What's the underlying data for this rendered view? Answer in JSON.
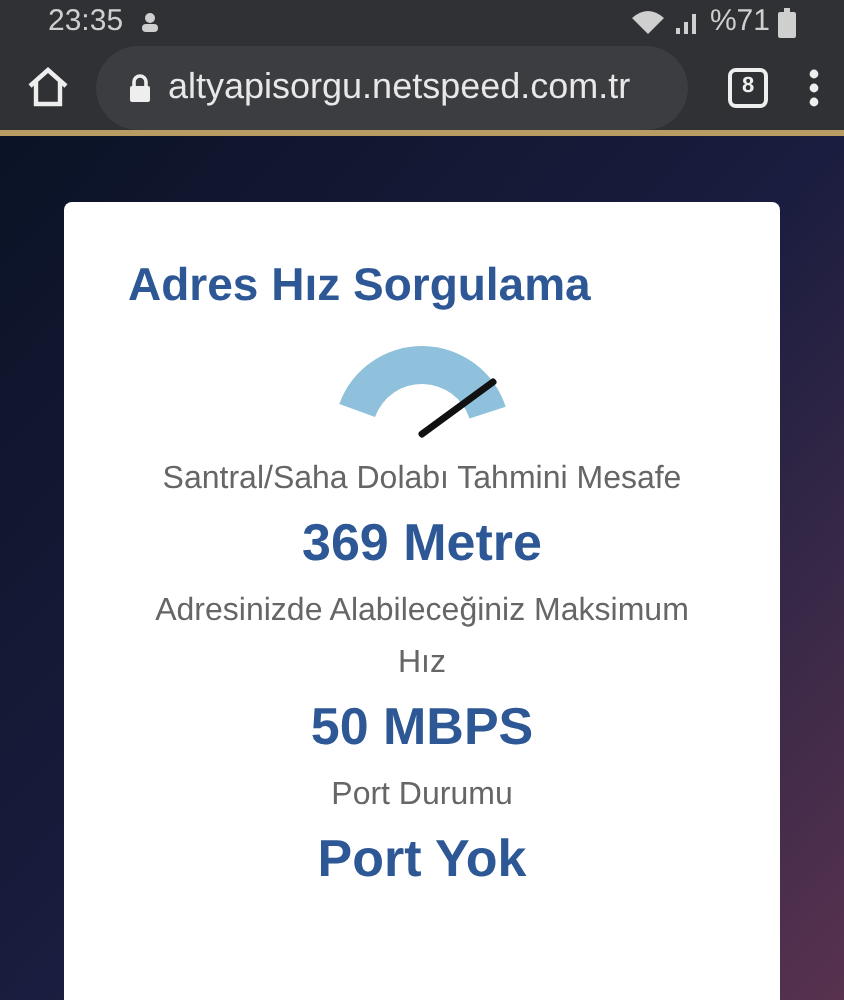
{
  "status_bar": {
    "time": "23:35",
    "battery": "%71"
  },
  "browser": {
    "url": "altyapisorgu.netspeed.com.tr",
    "tab_count": "8"
  },
  "card": {
    "title": "Adres Hız Sorgulama",
    "items": [
      {
        "kind": "label",
        "text": "Santral/Saha Dolabı Tahmini Mesafe"
      },
      {
        "kind": "value",
        "text": "369 Metre"
      },
      {
        "kind": "label",
        "text": "Adresinizde Alabileceğiniz Maksimum Hız"
      },
      {
        "kind": "value",
        "text": "50 MBPS"
      },
      {
        "kind": "label",
        "text": "Port Durumu"
      },
      {
        "kind": "value",
        "text": "Port Yok"
      }
    ]
  }
}
